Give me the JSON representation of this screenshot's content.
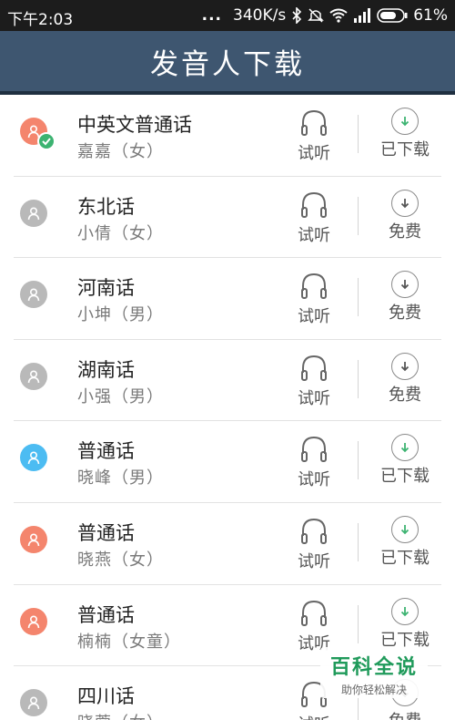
{
  "status_bar": {
    "time": "下午2:03",
    "dots": "...",
    "speed": "340K/s",
    "battery": "61%"
  },
  "header": {
    "title": "发音人下载"
  },
  "colors": {
    "header_bg": "#3e5670",
    "avatar_gray": "#b9b9b9",
    "avatar_orange": "#f4856d",
    "avatar_blue": "#4cbcf2",
    "downloaded_green": "#3cb371"
  },
  "voices": [
    {
      "name": "中英文普通话",
      "speaker": "嘉嘉（女）",
      "avatar_color": "orange",
      "selected": true,
      "listen_label": "试听",
      "action_label": "已下载",
      "downloaded": true
    },
    {
      "name": "东北话",
      "speaker": "小倩（女）",
      "avatar_color": "gray",
      "selected": false,
      "listen_label": "试听",
      "action_label": "免费",
      "downloaded": false
    },
    {
      "name": "河南话",
      "speaker": "小坤（男）",
      "avatar_color": "gray",
      "selected": false,
      "listen_label": "试听",
      "action_label": "免费",
      "downloaded": false
    },
    {
      "name": "湖南话",
      "speaker": "小强（男）",
      "avatar_color": "gray",
      "selected": false,
      "listen_label": "试听",
      "action_label": "免费",
      "downloaded": false
    },
    {
      "name": "普通话",
      "speaker": "晓峰（男）",
      "avatar_color": "blue",
      "selected": false,
      "listen_label": "试听",
      "action_label": "已下载",
      "downloaded": true
    },
    {
      "name": "普通话",
      "speaker": "晓燕（女）",
      "avatar_color": "orange",
      "selected": false,
      "listen_label": "试听",
      "action_label": "已下载",
      "downloaded": true
    },
    {
      "name": "普通话",
      "speaker": "楠楠（女童）",
      "avatar_color": "orange",
      "selected": false,
      "listen_label": "试听",
      "action_label": "已下载",
      "downloaded": true
    },
    {
      "name": "四川话",
      "speaker": "晓蓉（女）",
      "avatar_color": "gray",
      "selected": false,
      "listen_label": "试听",
      "action_label": "免费",
      "downloaded": false
    }
  ],
  "watermark": {
    "title": "百科全说",
    "subtitle": "助你轻松解决"
  }
}
